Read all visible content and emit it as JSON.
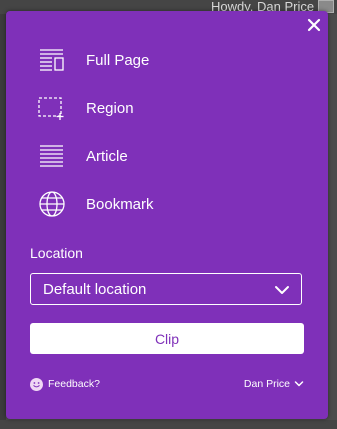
{
  "background": {
    "greeting": "Howdy, Dan Price"
  },
  "clipper": {
    "options": [
      {
        "label": "Full Page",
        "icon": "full-page-icon"
      },
      {
        "label": "Region",
        "icon": "region-icon"
      },
      {
        "label": "Article",
        "icon": "article-icon"
      },
      {
        "label": "Bookmark",
        "icon": "globe-icon"
      }
    ],
    "location_label": "Location",
    "location_value": "Default location",
    "clip_label": "Clip",
    "feedback_label": "Feedback?",
    "user_label": "Dan Price",
    "accent_color": "#7f30b9"
  }
}
